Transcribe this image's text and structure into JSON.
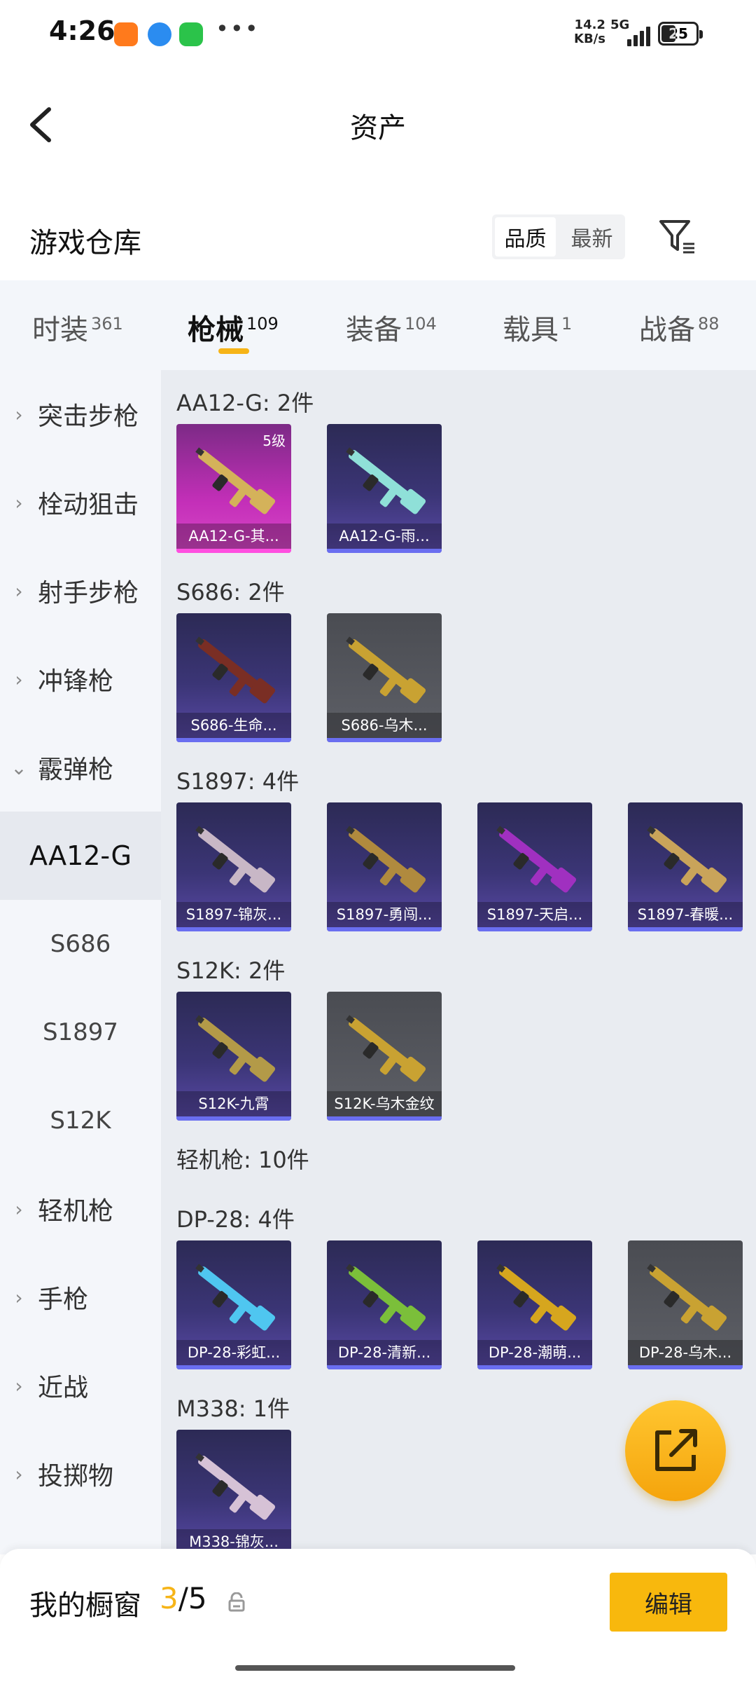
{
  "status": {
    "time": "4:26",
    "net_speed_value": "14.2",
    "net_speed_unit": "KB/s",
    "network": "5G",
    "battery": "25",
    "more_dots": "•••",
    "app_icons": [
      "taobao-icon",
      "browser-icon",
      "messages-icon"
    ]
  },
  "header": {
    "title": "资产"
  },
  "section": {
    "title": "游戏仓库",
    "sort_options": [
      "品质",
      "最新"
    ],
    "active_sort": "品质"
  },
  "category_tabs": [
    {
      "label": "时装",
      "count": "361"
    },
    {
      "label": "枪械",
      "count": "109",
      "active": true
    },
    {
      "label": "装备",
      "count": "104"
    },
    {
      "label": "载具",
      "count": "1"
    },
    {
      "label": "战备",
      "count": "88"
    }
  ],
  "sidebar": {
    "categories": [
      "突击步枪",
      "栓动狙击",
      "射手步枪",
      "冲锋枪",
      "霰弹枪"
    ],
    "expanded": "霰弹枪",
    "sub_items": [
      "AA12-G",
      "S686",
      "S1897",
      "S12K"
    ],
    "active_sub": "AA12-G",
    "more_categories": [
      "轻机枪",
      "手枪",
      "近战",
      "投掷物"
    ]
  },
  "groups": [
    {
      "title": "AA12-G: 2件",
      "items": [
        {
          "label": "AA12-G-其...",
          "level": "5级",
          "style": "pink",
          "weapon_color": "#d4b25a"
        },
        {
          "label": "AA12-G-雨...",
          "style": "purple",
          "weapon_color": "#8fe0d8"
        }
      ]
    },
    {
      "title": "S686: 2件",
      "items": [
        {
          "label": "S686-生命...",
          "style": "purple",
          "weapon_color": "#7a2e24"
        },
        {
          "label": "S686-乌木...",
          "style": "gray",
          "weapon_color": "#c9a232"
        }
      ]
    },
    {
      "title": "S1897: 4件",
      "items": [
        {
          "label": "S1897-锦灰...",
          "style": "purple",
          "weapon_color": "#c8b7c6"
        },
        {
          "label": "S1897-勇闯...",
          "style": "purple",
          "weapon_color": "#b08a3e"
        },
        {
          "label": "S1897-天启...",
          "style": "purple",
          "weapon_color": "#a030c0"
        },
        {
          "label": "S1897-春暖...",
          "style": "purple",
          "weapon_color": "#c9a45a"
        }
      ]
    },
    {
      "title": "S12K: 2件",
      "items": [
        {
          "label": "S12K-九霄",
          "style": "purple",
          "weapon_color": "#b39a48"
        },
        {
          "label": "S12K-乌木金纹",
          "style": "gray",
          "weapon_color": "#c9a232"
        }
      ]
    },
    {
      "title": "轻机枪: 10件",
      "items": []
    },
    {
      "title": "DP-28: 4件",
      "items": [
        {
          "label": "DP-28-彩虹...",
          "style": "purple",
          "weapon_color": "#4fc6f0"
        },
        {
          "label": "DP-28-清新...",
          "style": "purple",
          "weapon_color": "#7bbf3a"
        },
        {
          "label": "DP-28-潮萌...",
          "style": "purple",
          "weapon_color": "#d6a61e"
        },
        {
          "label": "DP-28-乌木...",
          "style": "gray",
          "weapon_color": "#c9a232"
        }
      ]
    },
    {
      "title": "M338: 1件",
      "items": [
        {
          "label": "M338-锦灰...",
          "style": "purple",
          "weapon_color": "#d6c2d6"
        }
      ]
    }
  ],
  "bottom": {
    "showcase_label": "我的橱窗",
    "showcase_current": "3",
    "showcase_sep": "/",
    "showcase_total": "5",
    "edit_label": "编辑"
  },
  "colors": {
    "accent": "#f6b417",
    "card_purple": "#3b3576",
    "card_pink": "#c32fb8",
    "card_gray": "#5e6067"
  }
}
